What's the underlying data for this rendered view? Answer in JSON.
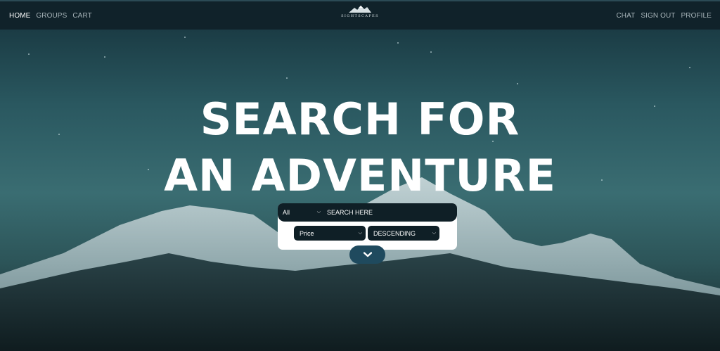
{
  "nav": {
    "left": [
      {
        "label": "HOME",
        "active": true
      },
      {
        "label": "GROUPS",
        "active": false
      },
      {
        "label": "CART",
        "active": false
      }
    ],
    "right": [
      {
        "label": "CHAT"
      },
      {
        "label": "SIGN OUT"
      },
      {
        "label": "PROFILE"
      }
    ],
    "logo_text": "SIGHTSCAPES",
    "logo_icon": "mountain-logo-icon"
  },
  "hero": {
    "line1": "SEARCH FOR",
    "line2": "AN ADVENTURE"
  },
  "search": {
    "category_value": "All",
    "placeholder": "SEARCH HERE",
    "sort_field_value": "Price",
    "sort_order_value": "DESCENDING",
    "expand_icon": "chevron-down-icon"
  },
  "colors": {
    "navbar_bg": "#10222a",
    "panel_dark": "#0f1f26",
    "expand_button": "#1f4a5e",
    "nav_active": "#ffffff",
    "nav_inactive": "#a8b5ba"
  }
}
